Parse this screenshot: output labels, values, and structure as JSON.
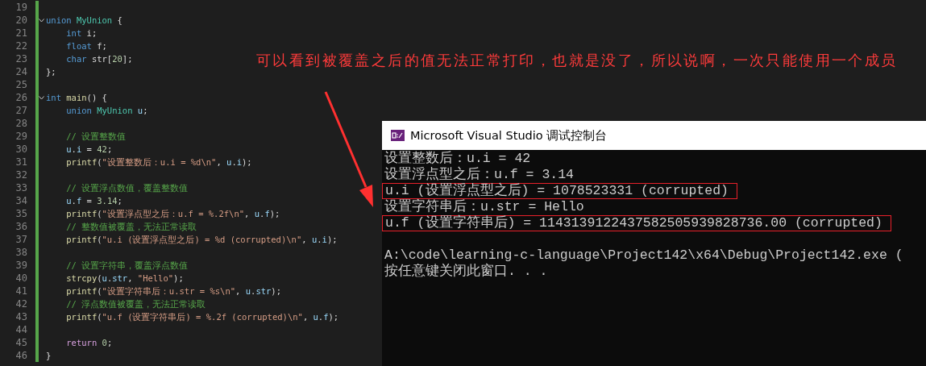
{
  "editor": {
    "lines": [
      {
        "number": "19",
        "foldable": false
      },
      {
        "number": "20",
        "foldable": true,
        "tokens": [
          {
            "text": "union ",
            "kind": "keyword"
          },
          {
            "text": "MyUnion",
            "kind": "type"
          },
          {
            "text": " {",
            "kind": "plain"
          }
        ]
      },
      {
        "number": "21",
        "foldable": false,
        "tokens": [
          {
            "text": "    int",
            "kind": "keyword"
          },
          {
            "text": " i;",
            "kind": "plain"
          }
        ]
      },
      {
        "number": "22",
        "foldable": false,
        "tokens": [
          {
            "text": "    float",
            "kind": "keyword"
          },
          {
            "text": " f;",
            "kind": "plain"
          }
        ]
      },
      {
        "number": "23",
        "foldable": false,
        "tokens": [
          {
            "text": "    char",
            "kind": "keyword"
          },
          {
            "text": " str[",
            "kind": "plain"
          },
          {
            "text": "20",
            "kind": "number"
          },
          {
            "text": "];",
            "kind": "plain"
          }
        ]
      },
      {
        "number": "24",
        "foldable": false,
        "tokens": [
          {
            "text": "};",
            "kind": "plain"
          }
        ]
      },
      {
        "number": "25",
        "foldable": false
      },
      {
        "number": "26",
        "foldable": true,
        "tokens": [
          {
            "text": "int ",
            "kind": "keyword"
          },
          {
            "text": "main",
            "kind": "function"
          },
          {
            "text": "() {",
            "kind": "plain"
          }
        ]
      },
      {
        "number": "27",
        "foldable": false,
        "tokens": [
          {
            "text": "    union ",
            "kind": "keyword"
          },
          {
            "text": "MyUnion ",
            "kind": "type"
          },
          {
            "text": "u",
            "kind": "variable"
          },
          {
            "text": ";",
            "kind": "plain"
          }
        ]
      },
      {
        "number": "28",
        "foldable": false
      },
      {
        "number": "29",
        "foldable": false,
        "tokens": [
          {
            "text": "    // 设置整数值",
            "kind": "comment"
          }
        ]
      },
      {
        "number": "30",
        "foldable": false,
        "tokens": [
          {
            "text": "    u",
            "kind": "variable"
          },
          {
            "text": ".",
            "kind": "plain"
          },
          {
            "text": "i",
            "kind": "variable"
          },
          {
            "text": " = ",
            "kind": "plain"
          },
          {
            "text": "42",
            "kind": "number"
          },
          {
            "text": ";",
            "kind": "plain"
          }
        ]
      },
      {
        "number": "31",
        "foldable": false,
        "tokens": [
          {
            "text": "    printf",
            "kind": "function"
          },
          {
            "text": "(",
            "kind": "plain"
          },
          {
            "text": "\"设置整数后：u.i = %d\\n\"",
            "kind": "string"
          },
          {
            "text": ", ",
            "kind": "plain"
          },
          {
            "text": "u",
            "kind": "variable"
          },
          {
            "text": ".",
            "kind": "plain"
          },
          {
            "text": "i",
            "kind": "variable"
          },
          {
            "text": ");",
            "kind": "plain"
          }
        ]
      },
      {
        "number": "32",
        "foldable": false
      },
      {
        "number": "33",
        "foldable": false,
        "tokens": [
          {
            "text": "    // 设置浮点数值，覆盖整数值",
            "kind": "comment"
          }
        ]
      },
      {
        "number": "34",
        "foldable": false,
        "tokens": [
          {
            "text": "    u",
            "kind": "variable"
          },
          {
            "text": ".",
            "kind": "plain"
          },
          {
            "text": "f",
            "kind": "variable"
          },
          {
            "text": " = ",
            "kind": "plain"
          },
          {
            "text": "3.14",
            "kind": "number"
          },
          {
            "text": ";",
            "kind": "plain"
          }
        ]
      },
      {
        "number": "35",
        "foldable": false,
        "tokens": [
          {
            "text": "    printf",
            "kind": "function"
          },
          {
            "text": "(",
            "kind": "plain"
          },
          {
            "text": "\"设置浮点型之后：u.f = %.2f\\n\"",
            "kind": "string"
          },
          {
            "text": ", ",
            "kind": "plain"
          },
          {
            "text": "u",
            "kind": "variable"
          },
          {
            "text": ".",
            "kind": "plain"
          },
          {
            "text": "f",
            "kind": "variable"
          },
          {
            "text": ");",
            "kind": "plain"
          }
        ]
      },
      {
        "number": "36",
        "foldable": false,
        "tokens": [
          {
            "text": "    // 整数值被覆盖，无法正常读取",
            "kind": "comment"
          }
        ]
      },
      {
        "number": "37",
        "foldable": false,
        "tokens": [
          {
            "text": "    printf",
            "kind": "function"
          },
          {
            "text": "(",
            "kind": "plain"
          },
          {
            "text": "\"u.i (设置浮点型之后) = %d (corrupted)\\n\"",
            "kind": "string"
          },
          {
            "text": ", ",
            "kind": "plain"
          },
          {
            "text": "u",
            "kind": "variable"
          },
          {
            "text": ".",
            "kind": "plain"
          },
          {
            "text": "i",
            "kind": "variable"
          },
          {
            "text": ");",
            "kind": "plain"
          }
        ]
      },
      {
        "number": "38",
        "foldable": false
      },
      {
        "number": "39",
        "foldable": false,
        "tokens": [
          {
            "text": "    // 设置字符串，覆盖浮点数值",
            "kind": "comment"
          }
        ]
      },
      {
        "number": "40",
        "foldable": false,
        "tokens": [
          {
            "text": "    strcpy",
            "kind": "function"
          },
          {
            "text": "(",
            "kind": "plain"
          },
          {
            "text": "u",
            "kind": "variable"
          },
          {
            "text": ".",
            "kind": "plain"
          },
          {
            "text": "str",
            "kind": "variable"
          },
          {
            "text": ", ",
            "kind": "plain"
          },
          {
            "text": "\"Hello\"",
            "kind": "string"
          },
          {
            "text": ");",
            "kind": "plain"
          }
        ]
      },
      {
        "number": "41",
        "foldable": false,
        "tokens": [
          {
            "text": "    printf",
            "kind": "function"
          },
          {
            "text": "(",
            "kind": "plain"
          },
          {
            "text": "\"设置字符串后：u.str = %s\\n\"",
            "kind": "string"
          },
          {
            "text": ", ",
            "kind": "plain"
          },
          {
            "text": "u",
            "kind": "variable"
          },
          {
            "text": ".",
            "kind": "plain"
          },
          {
            "text": "str",
            "kind": "variable"
          },
          {
            "text": ");",
            "kind": "plain"
          }
        ]
      },
      {
        "number": "42",
        "foldable": false,
        "tokens": [
          {
            "text": "    // 浮点数值被覆盖，无法正常读取",
            "kind": "comment"
          }
        ]
      },
      {
        "number": "43",
        "foldable": false,
        "tokens": [
          {
            "text": "    printf",
            "kind": "function"
          },
          {
            "text": "(",
            "kind": "plain"
          },
          {
            "text": "\"u.f (设置字符串后) = %.2f (corrupted)\\n\"",
            "kind": "string"
          },
          {
            "text": ", ",
            "kind": "plain"
          },
          {
            "text": "u",
            "kind": "variable"
          },
          {
            "text": ".",
            "kind": "plain"
          },
          {
            "text": "f",
            "kind": "variable"
          },
          {
            "text": ");",
            "kind": "plain"
          }
        ]
      },
      {
        "number": "44",
        "foldable": false
      },
      {
        "number": "45",
        "foldable": false,
        "tokens": [
          {
            "text": "    return ",
            "kind": "control"
          },
          {
            "text": "0",
            "kind": "number"
          },
          {
            "text": ";",
            "kind": "plain"
          }
        ]
      },
      {
        "number": "46",
        "foldable": false,
        "tokens": [
          {
            "text": "}",
            "kind": "plain"
          }
        ]
      }
    ]
  },
  "annotation": {
    "text": "可以看到被覆盖之后的值无法正常打印，也就是没了，所以说啊，一次只能使用一个成员"
  },
  "console": {
    "title": "Microsoft Visual Studio 调试控制台",
    "output_lines": [
      {
        "text": "设置整数后：u.i = 42",
        "highlighted": false
      },
      {
        "text": "设置浮点型之后：u.f = 3.14",
        "highlighted": false
      },
      {
        "text": "u.i (设置浮点型之后) = 1078523331 (corrupted)",
        "highlighted": true
      },
      {
        "text": "设置字符串后：u.str = Hello",
        "highlighted": false
      },
      {
        "text": "u.f (设置字符串后) = 1143139122437582505939828736.00 (corrupted)",
        "highlighted": true
      }
    ],
    "footer_lines": [
      {
        "text": "A:\\code\\learning-c-language\\Project142\\x64\\Debug\\Project142.exe ("
      },
      {
        "text": "按任意键关闭此窗口. . ."
      }
    ]
  }
}
